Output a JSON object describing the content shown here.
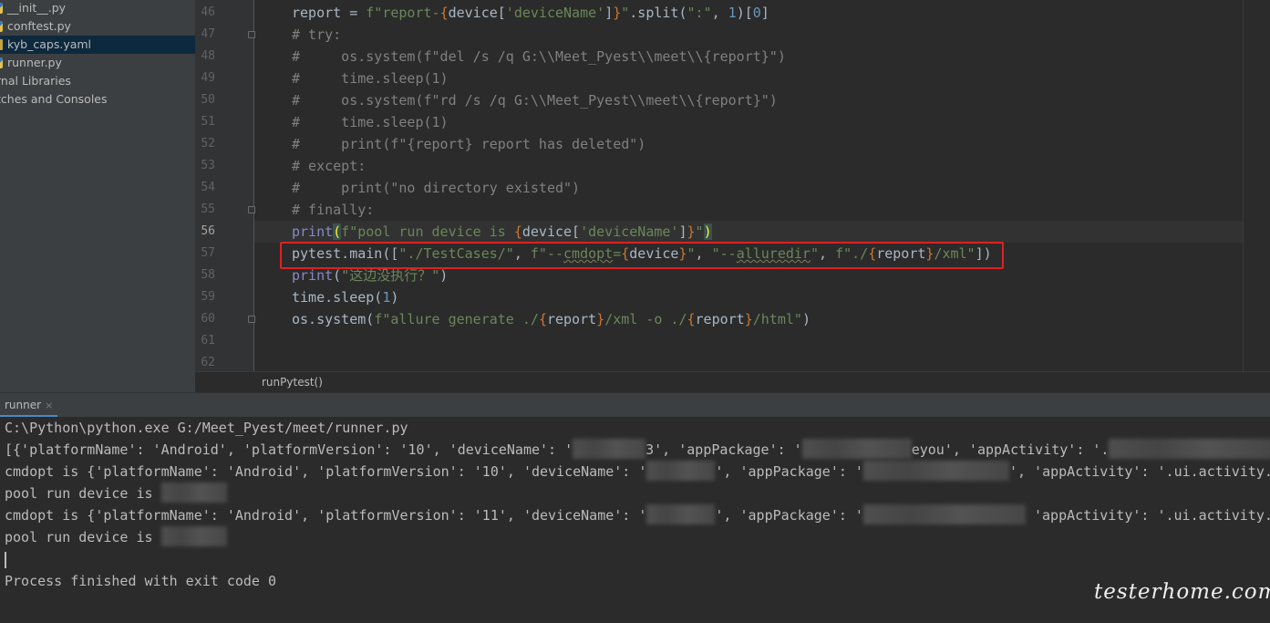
{
  "project_tree": {
    "items": [
      {
        "label": "__init__.py",
        "icon": "python-file-icon"
      },
      {
        "label": "conftest.py",
        "icon": "python-file-icon"
      },
      {
        "label": "kyb_caps.yaml",
        "icon": "yaml-file-icon",
        "selected": true
      },
      {
        "label": "runner.py",
        "icon": "python-file-icon"
      },
      {
        "label": "rnal Libraries"
      },
      {
        "label": "tches and Consoles"
      }
    ]
  },
  "editor": {
    "line_numbers": [
      "46",
      "47",
      "48",
      "49",
      "50",
      "51",
      "52",
      "53",
      "54",
      "55",
      "56",
      "57",
      "58",
      "59",
      "60",
      "61",
      "62"
    ],
    "current_line": "56",
    "breadcrumb": "runPytest()"
  },
  "run_panel": {
    "tab_label": "runner",
    "tab_close": "×",
    "console": {
      "cmd": "C:\\Python\\python.exe G:/Meet_Pyest/meet/runner.py",
      "line2_a": "[{'platformName': 'Android', 'platformVersion': '10', 'deviceName': '",
      "line2_b": "3', 'appPackage': '",
      "line2_c": "eyou', 'appActivity': '.",
      "line2_d": "you",
      "line3_a": "cmdopt is {'platformName': 'Android', 'platformVersion': '10', 'deviceName': '",
      "line3_b": "', 'appPackage': '",
      "line3_c": "', 'appActivity': '.ui.activity.ma",
      "line4": "pool run device is ",
      "line5_a": "cmdopt is {'platformName': 'Android', 'platformVersion': '11', 'deviceName': '",
      "line5_b": "', 'appPackage': '",
      "line5_c": " 'appActivity': '.ui.activity.ma",
      "line6": "pool run device is ",
      "finished": "Process finished with exit code 0"
    }
  },
  "code": {
    "l46": {
      "a": "report = ",
      "b": "f\"report-",
      "c": "{",
      "d": "device[",
      "e": "'deviceName'",
      "f": "]",
      "g": "}",
      "h": "\"",
      "i": ".split(",
      "j": "\":\"",
      "k": ", ",
      "l": "1",
      "m": ")[",
      "n": "0",
      "o": "]"
    },
    "l47": "# try:",
    "l48": "#     os.system(f\"del /s /q G:\\\\Meet_Pyest\\\\meet\\\\{report}\")",
    "l49": "#     time.sleep(1)",
    "l50": "#     os.system(f\"rd /s /q G:\\\\Meet_Pyest\\\\meet\\\\{report}\")",
    "l51": "#     time.sleep(1)",
    "l52": "#     print(f\"{report} report has deleted\")",
    "l53": "# except:",
    "l54": "#     print(\"no directory existed\")",
    "l55": "# finally:",
    "l56": {
      "a": "print",
      "b": "(",
      "c": "f\"pool run device is ",
      "d": "{",
      "e": "device[",
      "f": "'deviceName'",
      "g": "]",
      "h": "}",
      "i": "\"",
      "j": ")"
    },
    "l57": {
      "a": "pytest.main([",
      "b": "\"./TestCases/\"",
      "c": ", ",
      "d": "f\"--",
      "e": "cmdopt",
      "f": "=",
      "g": "{",
      "h": "device",
      "i": "}",
      "j": "\"",
      "k": ", ",
      "l": "\"--",
      "m": "alluredir",
      "n": "\"",
      "o": ", ",
      "p": "f\"./",
      "q": "{",
      "r": "report",
      "s": "}",
      "t": "/xml\"",
      "u": "])"
    },
    "l58": {
      "a": "print",
      "b": "(",
      "c": "\"这边没执行？\"",
      "d": ")"
    },
    "l59": {
      "a": "time.sleep(",
      "b": "1",
      "c": ")"
    },
    "l60": {
      "a": "os.system(",
      "b": "f\"allure generate ./",
      "c": "{",
      "d": "report",
      "e": "}",
      "f": "/xml -o ./",
      "g": "{",
      "h": "report",
      "i": "}",
      "j": "/html\"",
      "k": ")"
    }
  },
  "watermark": "testerhome.com"
}
